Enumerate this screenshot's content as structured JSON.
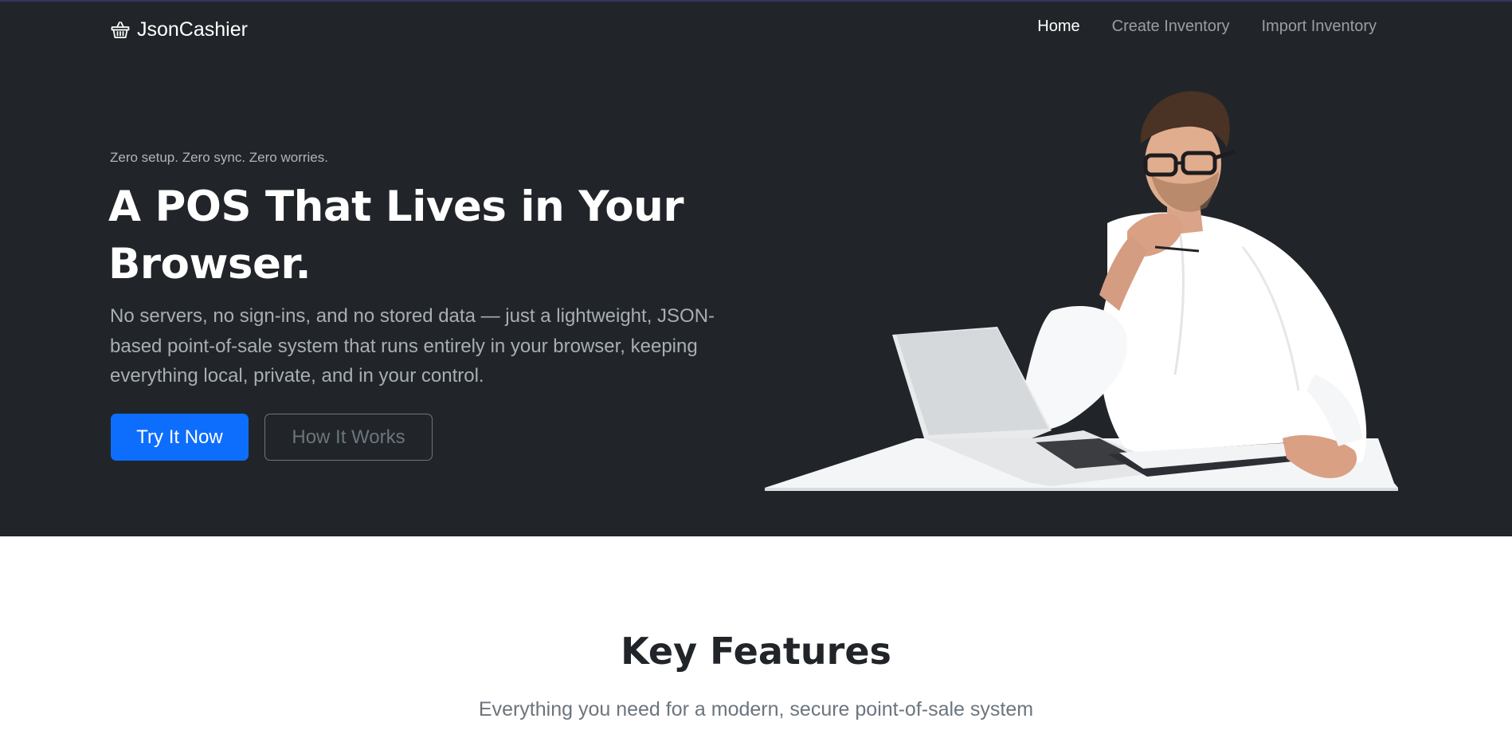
{
  "brand": {
    "name": "JsonCashier",
    "icon": "basket-icon"
  },
  "nav": {
    "items": [
      {
        "label": "Home",
        "active": true
      },
      {
        "label": "Create Inventory",
        "active": false
      },
      {
        "label": "Import Inventory",
        "active": false
      }
    ]
  },
  "hero": {
    "tagline": "Zero setup. Zero sync. Zero worries.",
    "headline": "A POS That Lives in Your Browser.",
    "lead": "No servers, no sign-ins, and no stored data — just a lightweight, JSON-based point-of-sale system that runs entirely in your browser, keeping everything local, private, and in your control.",
    "primary_button": "Try It Now",
    "secondary_button": "How It Works"
  },
  "features": {
    "title": "Key Features",
    "subtitle": "Everything you need for a modern, secure point-of-sale system"
  },
  "colors": {
    "hero_bg": "#212529",
    "primary": "#0d6efd",
    "muted": "#6c757d"
  }
}
